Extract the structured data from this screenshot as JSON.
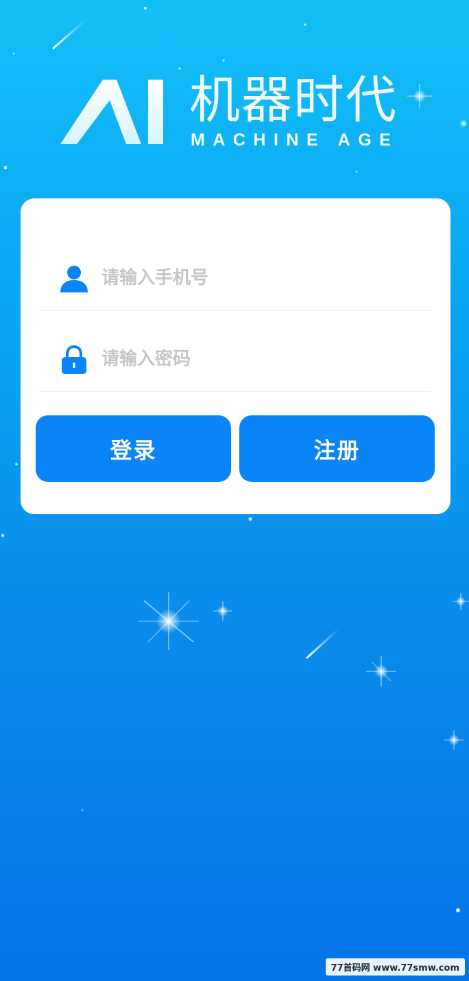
{
  "logo": {
    "mark": "AI",
    "title_cn": "机器时代",
    "title_en": "MACHINE AGE"
  },
  "form": {
    "phone": {
      "placeholder": "请输入手机号",
      "value": ""
    },
    "password": {
      "placeholder": "请输入密码",
      "value": ""
    }
  },
  "buttons": {
    "login_label": "登录",
    "register_label": "注册"
  },
  "watermark": "77首码网 www.77smw.com",
  "icons": {
    "phone_field": "user-icon",
    "password_field": "lock-icon"
  },
  "colors": {
    "accent": "#0a85f7",
    "background_top": "#14bff8",
    "background_bottom": "#0673e9",
    "placeholder": "#c6c6c6"
  }
}
